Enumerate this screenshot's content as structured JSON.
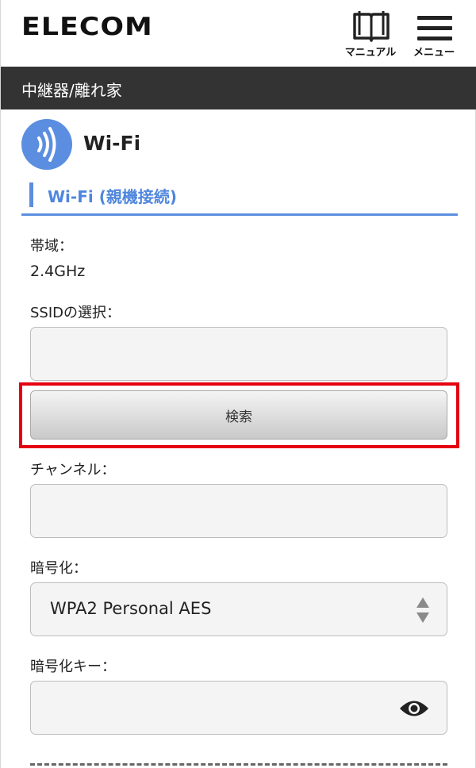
{
  "header": {
    "logo": "ELECOM",
    "manual_label": "マニュアル",
    "menu_label": "メニュー"
  },
  "breadcrumb": "中継器/離れ家",
  "section": {
    "title": "Wi-Fi",
    "subtitle": "Wi-Fi (親機接続)"
  },
  "form": {
    "band_label": "帯域：",
    "band_value": "2.4GHz",
    "ssid_label": "SSIDの選択：",
    "ssid_value": "",
    "search_button": "検索",
    "channel_label": "チャンネル：",
    "channel_value": "",
    "encryption_label": "暗号化：",
    "encryption_value": "WPA2 Personal AES",
    "key_label": "暗号化キー：",
    "key_value": ""
  },
  "colors": {
    "accent": "#5b8ee0",
    "highlight": "#e4000f",
    "bar": "#333333"
  },
  "icons": [
    "book-icon",
    "hamburger-icon",
    "wifi-icon",
    "select-arrows-icon",
    "eye-icon"
  ]
}
